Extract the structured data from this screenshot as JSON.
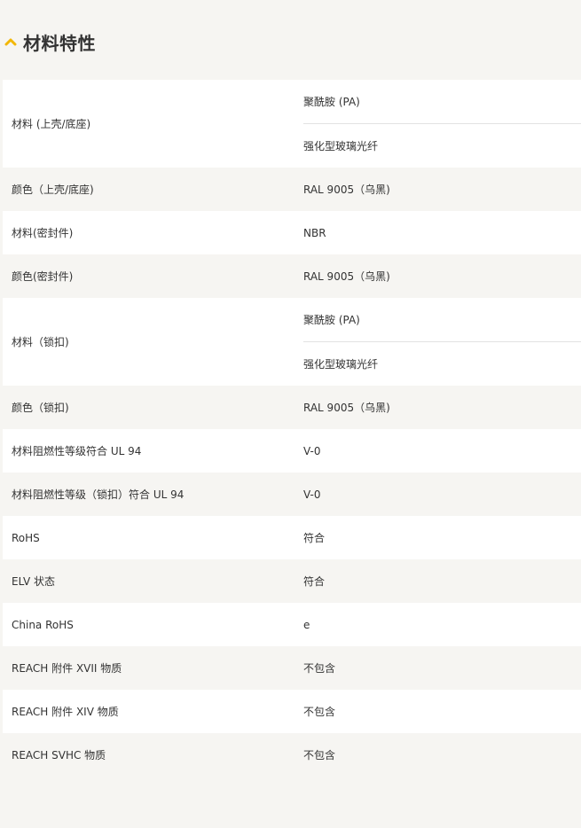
{
  "section": {
    "title": "材料特性",
    "icon": "chevron-up-icon",
    "accent_color": "#f2b705"
  },
  "rows": [
    {
      "label": "材料 (上壳/底座)",
      "values": [
        "聚酰胺 (PA)",
        "强化型玻璃光纤"
      ]
    },
    {
      "label": "颜色（上壳/底座)",
      "values": [
        "RAL 9005（乌黑)"
      ]
    },
    {
      "label": "材料(密封件)",
      "values": [
        "NBR"
      ]
    },
    {
      "label": "颜色(密封件)",
      "values": [
        "RAL 9005（乌黑)"
      ]
    },
    {
      "label": "材料（锁扣)",
      "values": [
        "聚酰胺 (PA)",
        "强化型玻璃光纤"
      ]
    },
    {
      "label": "颜色（锁扣)",
      "values": [
        "RAL 9005（乌黑)"
      ]
    },
    {
      "label": "材料阻燃性等级符合 UL 94",
      "values": [
        "V-0"
      ]
    },
    {
      "label": "材料阻燃性等级（锁扣）符合 UL 94",
      "values": [
        "V-0"
      ]
    },
    {
      "label": "RoHS",
      "values": [
        "符合"
      ]
    },
    {
      "label": "ELV 状态",
      "values": [
        "符合"
      ]
    },
    {
      "label": "China RoHS",
      "values": [
        "e"
      ]
    },
    {
      "label": "REACH 附件 XVII 物质",
      "values": [
        "不包含"
      ]
    },
    {
      "label": "REACH 附件 XIV 物质",
      "values": [
        "不包含"
      ]
    },
    {
      "label": "REACH SVHC 物质",
      "values": [
        "不包含"
      ]
    }
  ]
}
